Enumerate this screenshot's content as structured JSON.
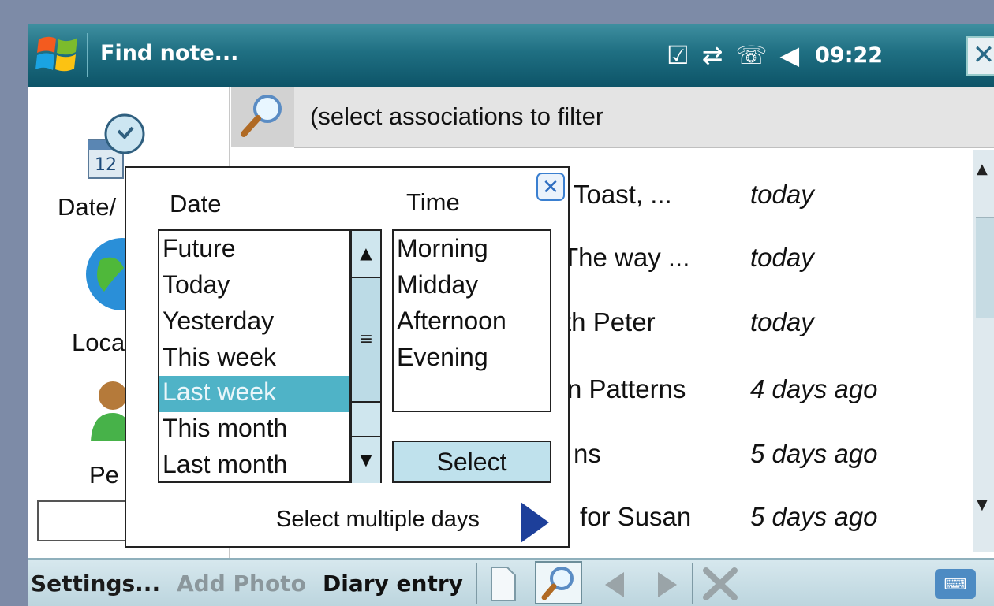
{
  "title": "Find note...",
  "status": {
    "time": "09:22"
  },
  "filter": {
    "text": "(select associations to filter"
  },
  "sidebar": {
    "items": [
      {
        "label": "Date/"
      },
      {
        "label": "Loca"
      },
      {
        "label": "Pe"
      }
    ]
  },
  "results": [
    {
      "title": "Toast, ...",
      "date": "today"
    },
    {
      "title": "The way ...",
      "date": "today"
    },
    {
      "title": "th Peter",
      "date": "today"
    },
    {
      "title": "n Patterns",
      "date": "4 days ago"
    },
    {
      "title": "ns",
      "date": "5 days ago"
    },
    {
      "title": "for Susan",
      "date": "5 days ago"
    }
  ],
  "popup": {
    "date_label": "Date",
    "time_label": "Time",
    "date_options": [
      "Future",
      "Today",
      "Yesterday",
      "This week",
      "Last week",
      "This month",
      "Last month"
    ],
    "selected_date": "Last week",
    "time_options": [
      "Morning",
      "Midday",
      "Afternoon",
      "Evening"
    ],
    "select_label": "Select",
    "multi_days_label": "Select multiple days"
  },
  "bottombar": {
    "settings": "Settings...",
    "add_photo": "Add Photo",
    "diary_entry": "Diary entry"
  },
  "colors": {
    "titlebar": "#1f6f82",
    "selection": "#4fb3c7",
    "background": "#7d8ba7"
  }
}
